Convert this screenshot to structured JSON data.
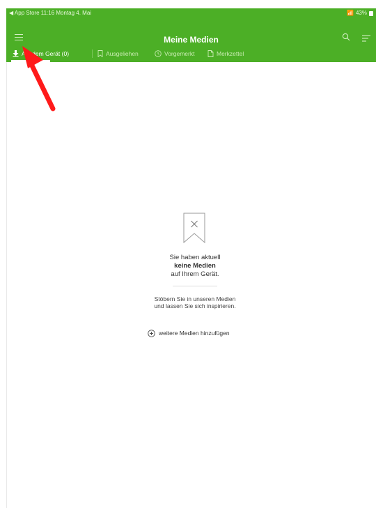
{
  "status_bar": {
    "left": "◀ App Store  11:16  Montag 4. Mai",
    "battery": "43%"
  },
  "header": {
    "title": "Meine Medien"
  },
  "tabs": [
    {
      "label": "Auf dem Gerät (0)",
      "icon": "download-icon"
    },
    {
      "label": "Ausgeliehen",
      "icon": "bookmark-icon"
    },
    {
      "label": "Vorgemerkt",
      "icon": "clock-icon"
    },
    {
      "label": "Merkzettel",
      "icon": "note-icon"
    }
  ],
  "empty_state": {
    "line1": "Sie haben aktuell",
    "line2": "keine Medien",
    "line3": "auf Ihrem Gerät.",
    "hint1": "Stöbern Sie in unseren Medien",
    "hint2": "und lassen Sie sich inspirieren.",
    "add_label": "weitere Medien hinzufügen"
  },
  "colors": {
    "brand": "#4caf26",
    "arrow": "#ff1a1a"
  }
}
